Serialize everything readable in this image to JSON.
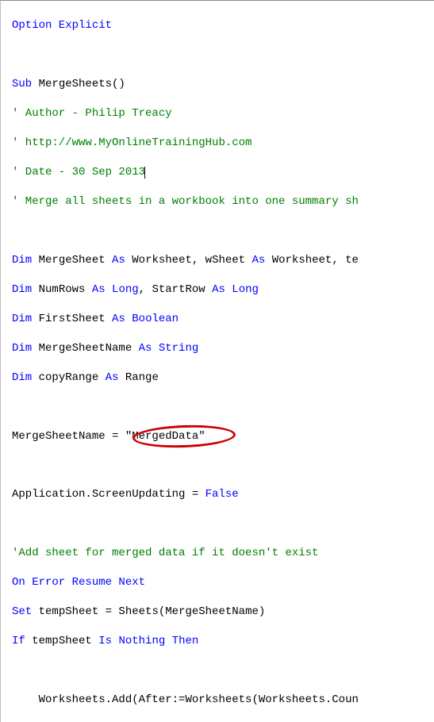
{
  "lines": {
    "l1_opt": "Option Explicit",
    "l3_sub": "Sub",
    "l3_name": " MergeSheets()",
    "l4": "' Author - Philip Treacy",
    "l5": "' http://www.MyOnlineTrainingHub.com",
    "l6": "' Date - 30 Sep 2013",
    "l7": "' Merge all sheets in a workbook into one summary sh",
    "l9_dim": "Dim",
    "l9_a": " MergeSheet ",
    "l9_as": "As",
    "l9_b": " Worksheet, wSheet ",
    "l9_as2": "As",
    "l9_c": " Worksheet, te",
    "l10_dim": "Dim",
    "l10_a": " NumRows ",
    "l10_as": "As",
    "l10_b": " Long",
    "l10_c": ", StartRow ",
    "l10_as2": "As",
    "l10_d": " Long",
    "l11_dim": "Dim",
    "l11_a": " FirstSheet ",
    "l11_as": "As",
    "l11_b": " Boolean",
    "l12_dim": "Dim",
    "l12_a": " MergeSheetName ",
    "l12_as": "As",
    "l12_b": " String",
    "l13_dim": "Dim",
    "l13_a": " copyRange ",
    "l13_as": "As",
    "l13_b": " Range",
    "l15_a": "MergeSheetName = ",
    "l15_str": "\"MergedData\"",
    "l17_a": "Application.ScreenUpdating = ",
    "l17_b": "False",
    "l19": "'Add sheet for merged data if it doesn't exist",
    "l20": "On Error Resume Next",
    "l21_set": "Set",
    "l21_a": " tempSheet = Sheets(MergeSheetName)",
    "l22_if": "If",
    "l22_a": " tempSheet ",
    "l22_is": "Is",
    "l22_b": " ",
    "l22_nothing": "Nothing",
    "l22_c": " ",
    "l22_then": "Then",
    "l24_a": "Worksheets.Add(After:=Worksheets(Worksheets.Coun"
  },
  "highlightTarget": "\"MergedData\""
}
